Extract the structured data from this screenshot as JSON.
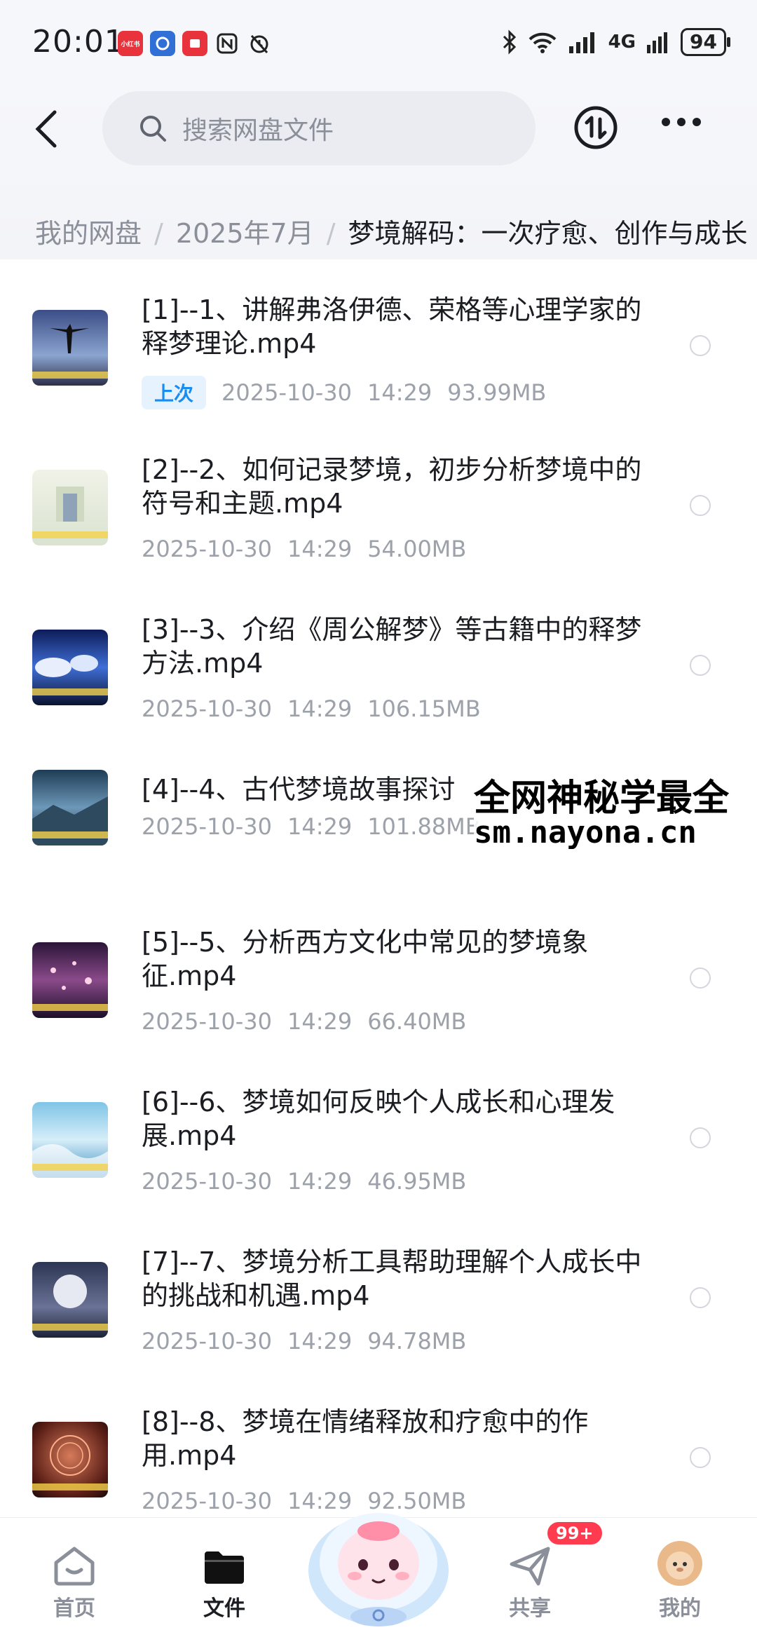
{
  "status_bar": {
    "time": "20:01",
    "app_icons": [
      "小红书",
      "app-icon",
      "app-icon",
      "nfc-icon",
      "alarm-icon"
    ],
    "signal_label": "4G",
    "battery": "94"
  },
  "header": {
    "search_placeholder": "搜索网盘文件",
    "breadcrumb": [
      "我的网盘",
      "2025年7月",
      "梦境解码：一次疗愈、创作与成长"
    ]
  },
  "files": [
    {
      "title": "[1]--1、讲解弗洛伊德、荣格等心理学家的释梦理论.mp4",
      "badge": "上次",
      "date": "2025-10-30",
      "time": "14:29",
      "size": "93.99MB"
    },
    {
      "title": "[2]--2、如何记录梦境，初步分析梦境中的符号和主题.mp4",
      "badge": "",
      "date": "2025-10-30",
      "time": "14:29",
      "size": "54.00MB"
    },
    {
      "title": "[3]--3、介绍《周公解梦》等古籍中的释梦方法.mp4",
      "badge": "",
      "date": "2025-10-30",
      "time": "14:29",
      "size": "106.15MB"
    },
    {
      "title": "[4]--4、古代梦境故事探讨",
      "badge": "",
      "date": "2025-10-30",
      "time": "14:29",
      "size": "101.88MB"
    },
    {
      "title": "[5]--5、分析西方文化中常见的梦境象征.mp4",
      "badge": "",
      "date": "2025-10-30",
      "time": "14:29",
      "size": "66.40MB"
    },
    {
      "title": "[6]--6、梦境如何反映个人成长和心理发展.mp4",
      "badge": "",
      "date": "2025-10-30",
      "time": "14:29",
      "size": "46.95MB"
    },
    {
      "title": "[7]--7、梦境分析工具帮助理解个人成长中的挑战和机遇.mp4",
      "badge": "",
      "date": "2025-10-30",
      "time": "14:29",
      "size": "94.78MB"
    },
    {
      "title": "[8]--8、梦境在情绪释放和疗愈中的作用.mp4",
      "badge": "",
      "date": "2025-10-30",
      "time": "14:29",
      "size": "92.50MB"
    }
  ],
  "watermark": {
    "line1": "全网神秘学最全",
    "line2": "sm.nayona.cn"
  },
  "tabbar": {
    "tabs": [
      "首页",
      "文件",
      "共享",
      "我的"
    ],
    "share_badge": "99+"
  },
  "colors": {
    "accent": "#1a8cf0",
    "badge_bg": "#e6f3ff",
    "notify": "#ff3b50",
    "text": "#1b1d22",
    "muted": "#9ca1aa"
  }
}
